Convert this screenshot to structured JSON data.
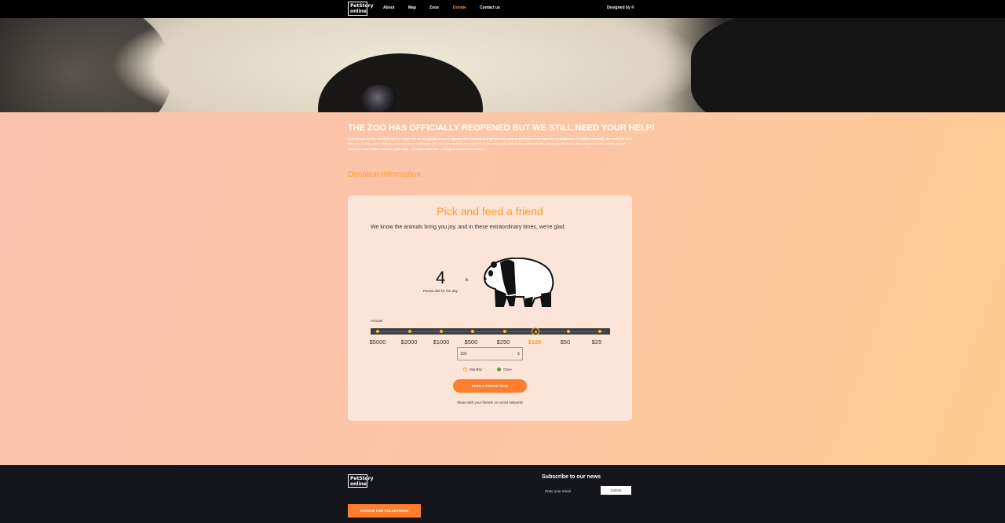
{
  "header": {
    "logo_line1": "PetStory",
    "logo_line2": "online",
    "nav": [
      {
        "label": "About"
      },
      {
        "label": "Map"
      },
      {
        "label": "Zoos"
      },
      {
        "label": "Donate"
      },
      {
        "label": "Contact us"
      }
    ],
    "active_nav": "Donate",
    "designed_by": "Designed by ©"
  },
  "main": {
    "headline": "THE ZOO HAS OFFICIALLY REOPENED BUT WE STILL NEED YOUR HELP!",
    "intro": "Even though the Zoo has been able to reopen, we are at a greatly reduced capacity with educational programs and public and private events cancelled or postponed for additional months. We need you more than ever to help ensure that we overcome these challenges. We have been actively raising funds in the community, and we are grateful for the generosity. But much more support is still needed, and we need your help! Please consider a gift today – no matter what size – to help us sustain our mission.",
    "donation_info": "Donation Information"
  },
  "card": {
    "title": "Pick and feed a friend",
    "subtitle": "We know the animals bring you joy, and in these extraordinary times, we're glad.",
    "count": "4",
    "times": "×",
    "count_label": "Panda diet for the day",
    "amount_label": "Amount",
    "amounts": [
      "$5000",
      "$2000",
      "$1000",
      "$500",
      "$250",
      "$100",
      "$50",
      "$25"
    ],
    "selected_amount": "$100",
    "input_value": "100",
    "currency": "$",
    "frequency": [
      {
        "label": "Monthly",
        "selected": false
      },
      {
        "label": "Once",
        "selected": true
      }
    ],
    "feed_button": "FEED A FRIEND NOW",
    "share_text": "Share with your friends on social networks"
  },
  "footer": {
    "logo_line1": "PetStory",
    "logo_line2": "online",
    "subscribe_title": "Subscribe to our news",
    "email_placeholder": "Enter your email",
    "submit_label": "Submit",
    "volunteers_button": "DONATE FOR VOLUNTEERS"
  },
  "colors": {
    "accent": "#ff9a1f",
    "button": "#ff7e2e",
    "header_bg": "#000000",
    "footer_bg": "#15161c",
    "slider_dot": "#f0c419",
    "radio_selected": "#57a227"
  },
  "icons": [
    "panda-icon",
    "currency-icon"
  ]
}
